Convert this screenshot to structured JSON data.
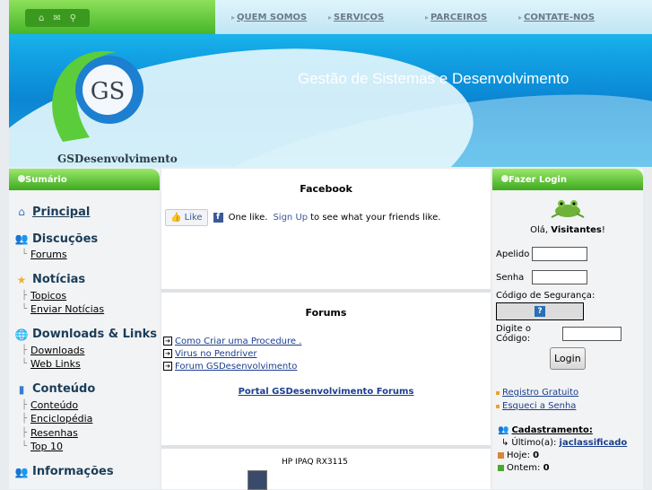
{
  "header": {
    "tagline": "Gestão de Sistemas e Desenvolvimento",
    "brand": "GSDesenvolvimento",
    "logo_text": "GS",
    "nav": [
      "QUEM SOMOS",
      "SERVIÇOS",
      "PARCEIROS",
      "CONTATE-NOS"
    ]
  },
  "left": {
    "title": "Sumário",
    "principal": "Principal",
    "discucoes": "Discuções",
    "forums": "Forums",
    "noticias": "Notícias",
    "topicos": "Topicos",
    "enviar": "Enviar Notícias",
    "downloads_links": "Downloads & Links",
    "downloads": "Downloads",
    "weblinks": "Web Links",
    "conteudo": "Conteúdo",
    "conteudo_sub": "Conteúdo",
    "enciclopedia": "Enciclopédia",
    "resenhas": "Resenhas",
    "top10": "Top 10",
    "informacoes": "Informações"
  },
  "mid": {
    "facebook_title": "Facebook",
    "like": "Like",
    "like_text_pre": "One like.",
    "signup": "Sign Up",
    "like_text_post": "to see what your friends like.",
    "forums_title": "Forums",
    "forum_items": [
      "Como Criar uma Procedure .",
      "Virus no Pendriver",
      "Forum GSDesenvolvimento"
    ],
    "portal": "Portal GSDesenvolvimento Forums",
    "product": "HP IPAQ RX3115"
  },
  "right": {
    "title": "Fazer Login",
    "greet_pre": "Olá,",
    "greet_user": "Visitantes",
    "greet_post": "!",
    "apelido": "Apelido",
    "senha": "Senha",
    "codigo_seg": "Código de Segurança:",
    "digite": "Digite o Código:",
    "login_btn": "Login",
    "registro": "Registro Gratuito",
    "esqueci": "Esqueci a Senha",
    "cadastramento": "Cadastramento:",
    "ultimo_label": "Último(a):",
    "ultimo_user": "jaclassificado",
    "hoje_label": "Hoje:",
    "hoje_val": "0",
    "ontem_label": "Ontem:",
    "ontem_val": "0"
  },
  "colors": {
    "accent_green": "#3ea91e",
    "link_blue": "#1c3e8e",
    "header_blue": "#0b86d3"
  }
}
